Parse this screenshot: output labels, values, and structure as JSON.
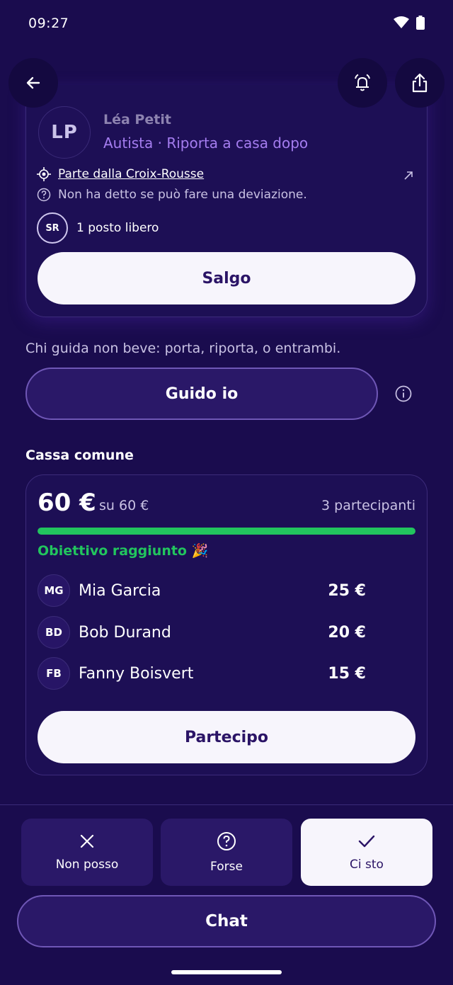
{
  "status_bar": {
    "time": "09:27"
  },
  "driver": {
    "initials": "LP",
    "name": "Léa Petit",
    "role": "Autista · Riporta a casa dopo",
    "departure": "Parte dalla Croix-Rousse",
    "detour_note": "Non ha detto se può fare una deviazione.",
    "seat_avatar": "SR",
    "seats": "1 posto libero",
    "join_label": "Salgo"
  },
  "drive": {
    "hint": "Chi guida non beve: porta, riporta, o entrambi.",
    "drive_label": "Guido io"
  },
  "fund": {
    "title": "Cassa comune",
    "amount": "60 €",
    "of": "su 60 €",
    "participants": "3 partecipanti",
    "progress": 1.0,
    "goal_text": "Obiettivo raggiunto 🎉",
    "contributors": [
      {
        "initials": "MG",
        "name": "Mia Garcia",
        "amount": "25 €"
      },
      {
        "initials": "BD",
        "name": "Bob Durand",
        "amount": "20 €"
      },
      {
        "initials": "FB",
        "name": "Fanny Boisvert",
        "amount": "15 €"
      }
    ],
    "participate_label": "Partecipo"
  },
  "rsvp": {
    "no_label": "Non posso",
    "maybe_label": "Forse",
    "yes_label": "Ci sto",
    "selected": "yes"
  },
  "chat_label": "Chat",
  "colors": {
    "accent": "#22c55e",
    "background": "#1a0c4e",
    "role_text": "#a57df0"
  }
}
